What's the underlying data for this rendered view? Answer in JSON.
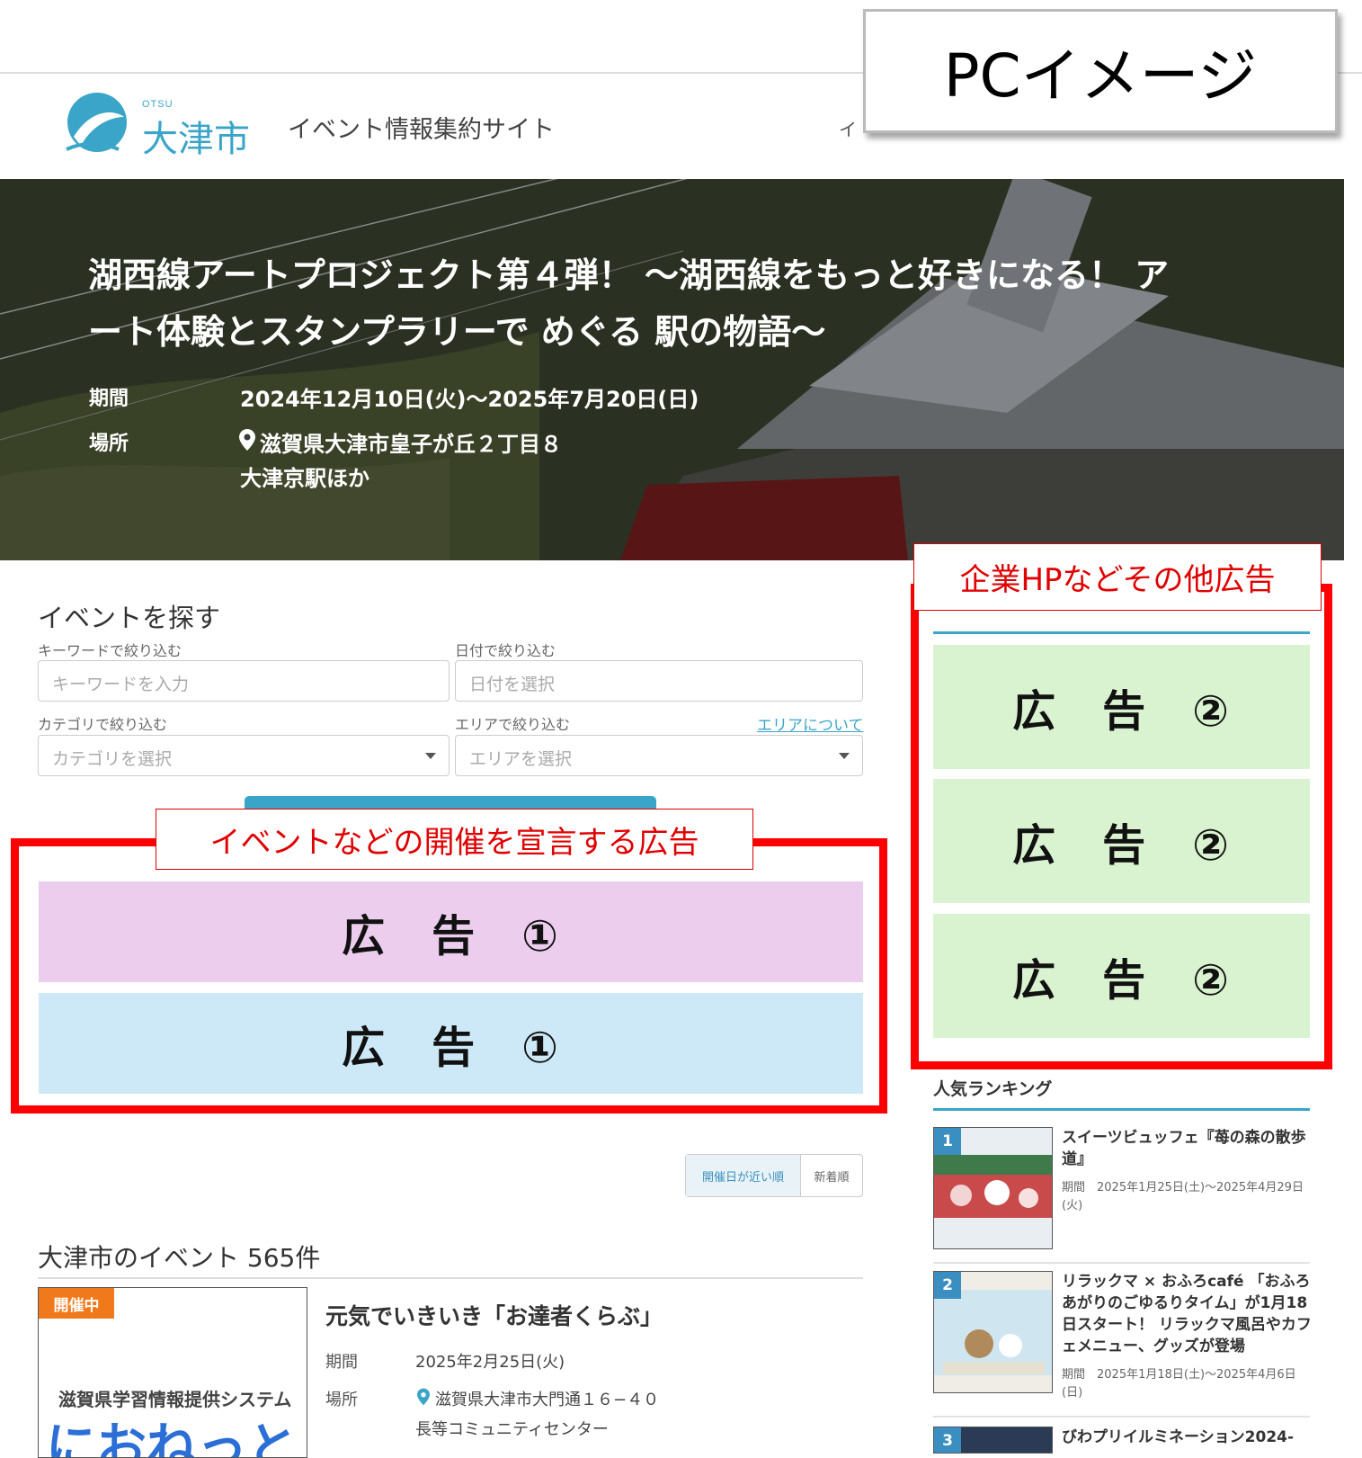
{
  "header": {
    "logo_small": "OTSU",
    "logo_text": "大津市",
    "site_title": "イベント情報集約サイト",
    "nav_stub": "イ"
  },
  "pc_label": "PCイメージ",
  "hero": {
    "title_line1": "湖西線アートプロジェクト第４弾！ ～湖西線をもっと好きになる！ ア",
    "title_line2": "ート体験とスタンプラリーで めぐる 駅の物語～",
    "period_label": "期間",
    "period_value": "2024年12月10日(火)～2025年7月20日(日)",
    "place_label": "場所",
    "place_value": "滋賀県大津市皇子が丘２丁目８",
    "place_value2": "大津京駅ほか"
  },
  "search": {
    "heading": "イベントを探す",
    "keyword_label": "キーワードで絞り込む",
    "keyword_placeholder": "キーワードを入力",
    "date_label": "日付で絞り込む",
    "date_placeholder": "日付を選択",
    "category_label": "カテゴリで絞り込む",
    "category_value": "カテゴリを選択",
    "area_label": "エリアで絞り込む",
    "area_link": "エリアについて",
    "area_value": "エリアを選択"
  },
  "ad1": {
    "caption": "イベントなどの開催を宣言する広告",
    "box1": "広　告　①",
    "box2": "広　告　①"
  },
  "ad2": {
    "caption": "企業HPなどその他広告",
    "box1": "広　告　②",
    "box2": "広　告　②",
    "box3": "広　告　②"
  },
  "ranking": {
    "heading": "人気ランキング",
    "items": [
      {
        "num": "1",
        "title": "スイーツビュッフェ『苺の森の散歩道』",
        "period": "期間　2025年1月25日(土)～2025年4月29日(火)"
      },
      {
        "num": "2",
        "title": "リラックマ × おふろcafé 「おふろあがりのごゆるりタイム」が1月18日スタート！ リラックマ風呂やカフェメニュー、グッズが登場",
        "period": "期間　2025年1月18日(土)～2025年4月6日(日)"
      },
      {
        "num": "3",
        "title": "びわプリイルミネーション2024-",
        "period": ""
      }
    ]
  },
  "sort": {
    "near": "開催日が近い順",
    "new": "新着順"
  },
  "events": {
    "heading": "大津市のイベント 565件",
    "item": {
      "badge": "開催中",
      "image_line1": "滋賀県学習情報提供システム",
      "image_line2": "におねっと",
      "title": "元気でいきいき「お達者くらぶ」",
      "period_label": "期間",
      "period_value": "2025年2月25日(火)",
      "place_label": "場所",
      "place_value": "滋賀県大津市大門通１６−４０",
      "place_value2": "長等コミュニティセンター"
    }
  },
  "colors": {
    "accent": "#3aa5c8",
    "ad_frame": "#ff0000",
    "ad1_pink": "#eccdee",
    "ad1_blue": "#cde9f7",
    "ad2_green": "#d9f2d0",
    "badge": "#f07a1b"
  }
}
